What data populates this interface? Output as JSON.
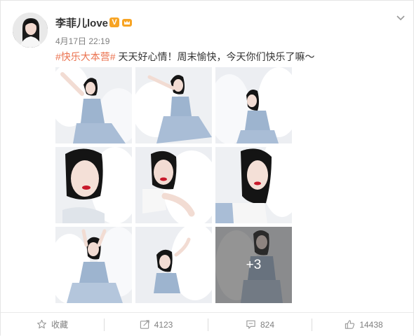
{
  "post": {
    "username": "李菲儿love",
    "verified_badge": "V",
    "timestamp": "4月17日 22:19",
    "hashtag": "#快乐大本营#",
    "text": " 天天好心情！周末愉快，今天你们快乐了嘛～",
    "more_photos_label": "+3"
  },
  "actions": {
    "favorite_label": "收藏",
    "repost_count": "4123",
    "comment_count": "824",
    "like_count": "14438"
  },
  "colors": {
    "hashtag": "#eb7350",
    "verified": "#f7a424",
    "text": "#333333",
    "muted": "#808080"
  },
  "icons": [
    "chevron-down-icon",
    "star-icon",
    "share-icon",
    "comment-icon",
    "thumbs-up-icon"
  ]
}
